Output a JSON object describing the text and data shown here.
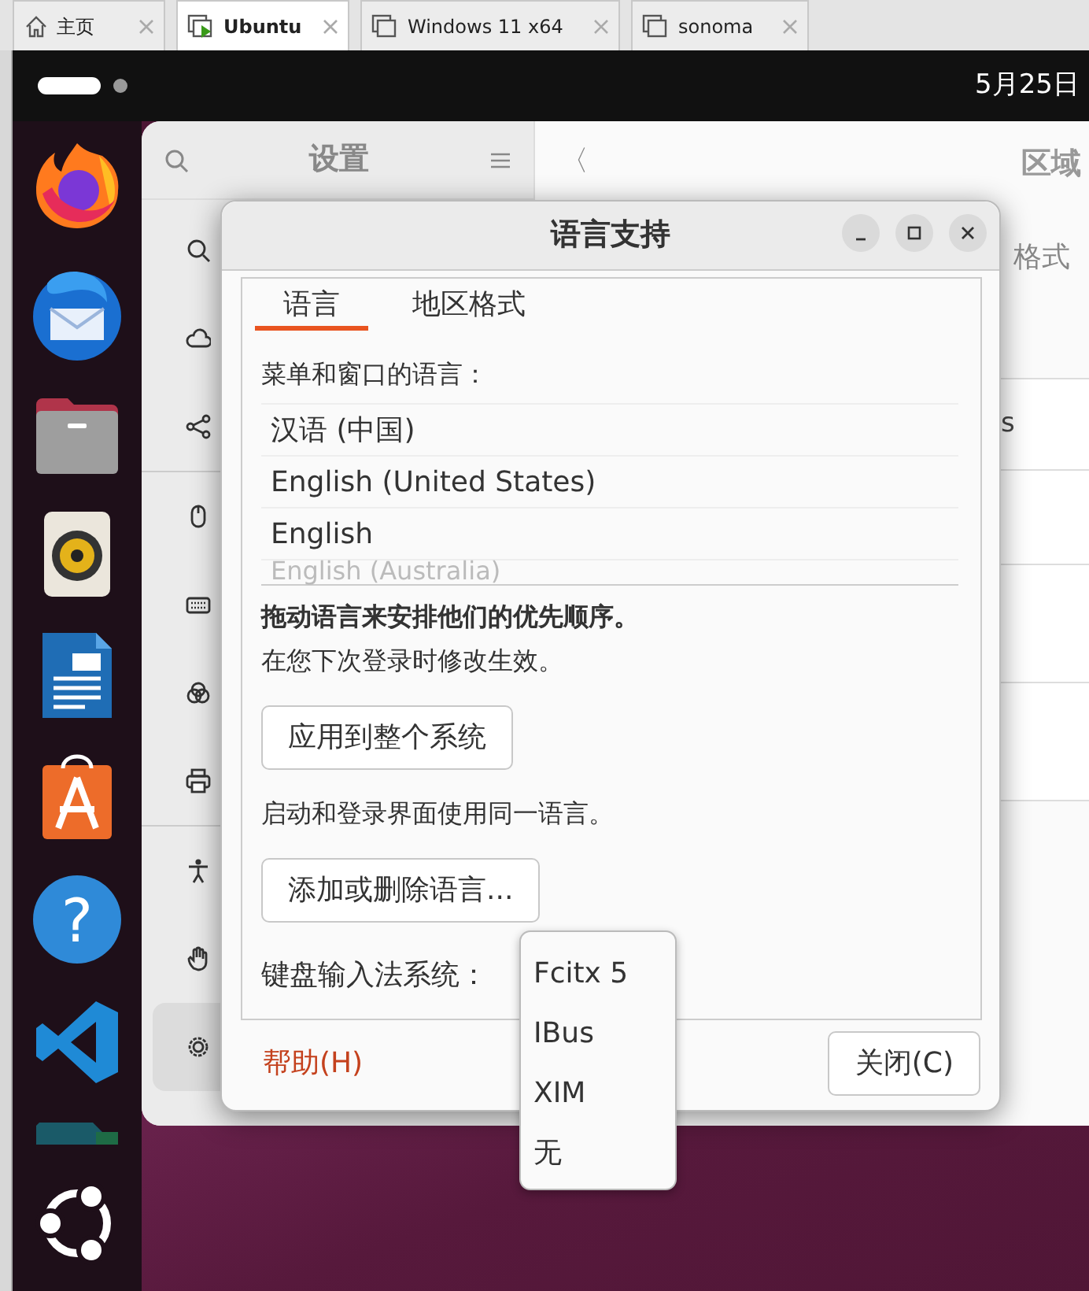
{
  "host_tabs": [
    {
      "label": "主页",
      "kind": "home",
      "selected": false
    },
    {
      "label": "Ubuntu",
      "kind": "vm-running",
      "selected": true
    },
    {
      "label": "Windows 11 x64",
      "kind": "vm",
      "selected": false
    },
    {
      "label": "sonoma",
      "kind": "vm",
      "selected": false
    }
  ],
  "top_bar": {
    "date": "5月25日"
  },
  "dock": [
    {
      "kind": "browser"
    },
    {
      "kind": "mail"
    },
    {
      "kind": "folder"
    },
    {
      "kind": "speaker"
    },
    {
      "kind": "document"
    },
    {
      "kind": "bag"
    },
    {
      "kind": "help",
      "glyph": "?"
    },
    {
      "kind": "code"
    },
    {
      "kind": "partial"
    },
    {
      "kind": "logo"
    }
  ],
  "settings": {
    "title": "设置",
    "back": "〈",
    "page_title": "区域",
    "subtitle": "格式",
    "row_text": "s",
    "sidebar": [
      {
        "kind": "search",
        "selected": false
      },
      {
        "kind": "cloud",
        "selected": false
      },
      {
        "kind": "share",
        "selected": false
      },
      {
        "kind": "mouse",
        "selected": false
      },
      {
        "kind": "keyboard",
        "selected": false
      },
      {
        "kind": "color",
        "selected": false
      },
      {
        "kind": "printer",
        "selected": false
      },
      {
        "kind": "accessibility",
        "selected": false
      },
      {
        "kind": "hand",
        "selected": false
      },
      {
        "kind": "gear",
        "selected": true
      }
    ]
  },
  "dialog": {
    "title": "语言支持",
    "tabs": [
      {
        "label": "语言",
        "selected": true
      },
      {
        "label": "地区格式",
        "selected": false
      }
    ],
    "languages_label": "菜单和窗口的语言：",
    "languages": [
      "汉语 (中国)",
      "English (United States)",
      "English",
      "English (Australia)"
    ],
    "drag_hint": "拖动语言来安排他们的优先顺序。",
    "relogin_hint": "在您下次登录时修改生效。",
    "apply_button": "应用到整个系统",
    "login_hint": "启动和登录界面使用同一语言。",
    "add_button": "添加或删除语言...",
    "im_label": "键盘输入法系统：",
    "im_options": [
      "Fcitx 5",
      "IBus",
      "XIM",
      "无"
    ],
    "help": "帮助(H)",
    "close": "关闭(C)"
  }
}
